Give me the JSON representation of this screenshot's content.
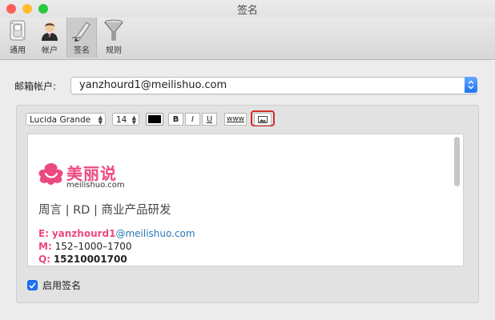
{
  "window": {
    "title": "签名",
    "traffic_colors": [
      "#fe5f57",
      "#febc2e",
      "#28c840"
    ]
  },
  "toolbar": {
    "items": [
      {
        "label": "通用",
        "icon": "general-switch-icon"
      },
      {
        "label": "帐户",
        "icon": "account-person-icon"
      },
      {
        "label": "签名",
        "icon": "signature-pen-icon",
        "active": true
      },
      {
        "label": "规则",
        "icon": "rules-funnel-icon"
      }
    ]
  },
  "account": {
    "label": "邮箱帐户:",
    "value": "yanzhourd1@meilishuo.com"
  },
  "format_bar": {
    "font": "Lucida Grande",
    "size": "14",
    "color": "#000000",
    "bold_label": "B",
    "italic_label": "I",
    "underline_label": "U",
    "link_label": "www",
    "image_icon": "image-icon"
  },
  "signature": {
    "logo_cn": "美丽说",
    "logo_en": "meilishuo.com",
    "name_line": "周言 | RD | 商业产品研发",
    "email_key": "E:",
    "email_user": "yanzhourd1",
    "email_domain": "@meilishuo.com",
    "mobile_key": "M:",
    "mobile_value": "152–1000–1700",
    "qq_key": "Q:",
    "qq_value": "15210001700",
    "brand_color": "#ec4a7e"
  },
  "enable": {
    "label": "启用签名",
    "checked": true
  }
}
